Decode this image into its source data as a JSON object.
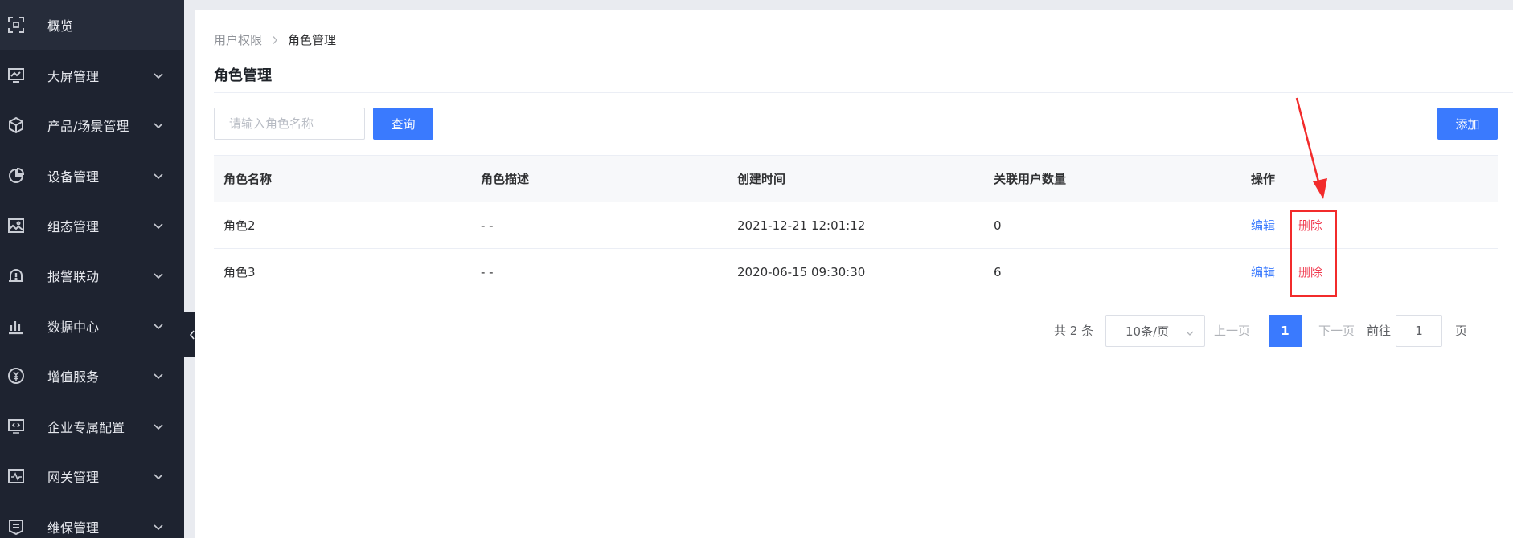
{
  "sidebar": {
    "items": [
      {
        "label": "概览",
        "icon": "scan-icon",
        "active": true,
        "has_chevron": false
      },
      {
        "label": "大屏管理",
        "icon": "monitor-icon",
        "has_chevron": true
      },
      {
        "label": "产品/场景管理",
        "icon": "cube-icon",
        "has_chevron": true
      },
      {
        "label": "设备管理",
        "icon": "pie-chart-icon",
        "has_chevron": true
      },
      {
        "label": "组态管理",
        "icon": "image-icon",
        "has_chevron": true
      },
      {
        "label": "报警联动",
        "icon": "alarm-icon",
        "has_chevron": true
      },
      {
        "label": "数据中心",
        "icon": "bar-chart-icon",
        "has_chevron": true
      },
      {
        "label": "增值服务",
        "icon": "yen-icon",
        "has_chevron": true
      },
      {
        "label": "企业专属配置",
        "icon": "code-screen-icon",
        "has_chevron": true
      },
      {
        "label": "网关管理",
        "icon": "gateway-icon",
        "has_chevron": true
      },
      {
        "label": "维保管理",
        "icon": "maintenance-icon",
        "has_chevron": true
      }
    ],
    "collapse_icon": "chevron-left-icon"
  },
  "breadcrumb": {
    "items": [
      "用户权限",
      "角色管理"
    ]
  },
  "page": {
    "title": "角色管理"
  },
  "search": {
    "placeholder": "请输入角色名称",
    "value": "",
    "query_label": "查询",
    "add_label": "添加"
  },
  "table": {
    "headers": [
      "角色名称",
      "角色描述",
      "创建时间",
      "关联用户数量",
      "操作"
    ],
    "rows": [
      {
        "name": "角色2",
        "description": "- -",
        "created": "2021-12-21 12:01:12",
        "user_count": "0",
        "edit": "编辑",
        "delete": "删除"
      },
      {
        "name": "角色3",
        "description": "- -",
        "created": "2020-06-15 09:30:30",
        "user_count": "6",
        "edit": "编辑",
        "delete": "删除"
      }
    ]
  },
  "pagination": {
    "total_text": "共 2 条",
    "page_size": "10条/页",
    "prev": "上一页",
    "current": "1",
    "next": "下一页",
    "goto_label": "前往",
    "goto_value": "1",
    "unit": "页"
  },
  "colors": {
    "sidebar_bg": "#1e2330",
    "primary": "#3a7afe",
    "danger": "#f03a4e",
    "annotation": "#f22b2b"
  }
}
